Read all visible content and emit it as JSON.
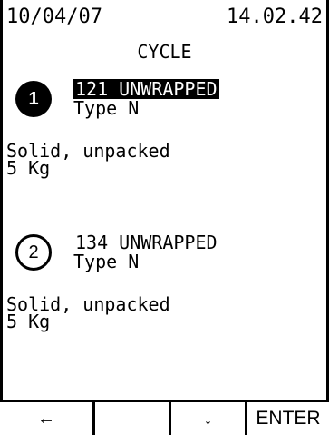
{
  "header": {
    "date": "10/04/07",
    "time": "14.02.42",
    "title": "CYCLE"
  },
  "items": [
    {
      "number": "1",
      "label": "121 UNWRAPPED",
      "type": "Type N",
      "description_line1": "Solid, unpacked",
      "description_line2": "5 Kg"
    },
    {
      "number": "2",
      "label": "134 UNWRAPPED",
      "type": "Type N",
      "description_line1": "Solid, unpacked",
      "description_line2": "5 Kg"
    }
  ],
  "softkeys": {
    "key1": "←",
    "key2": "",
    "key3": "↓",
    "key4": "ENTER"
  }
}
